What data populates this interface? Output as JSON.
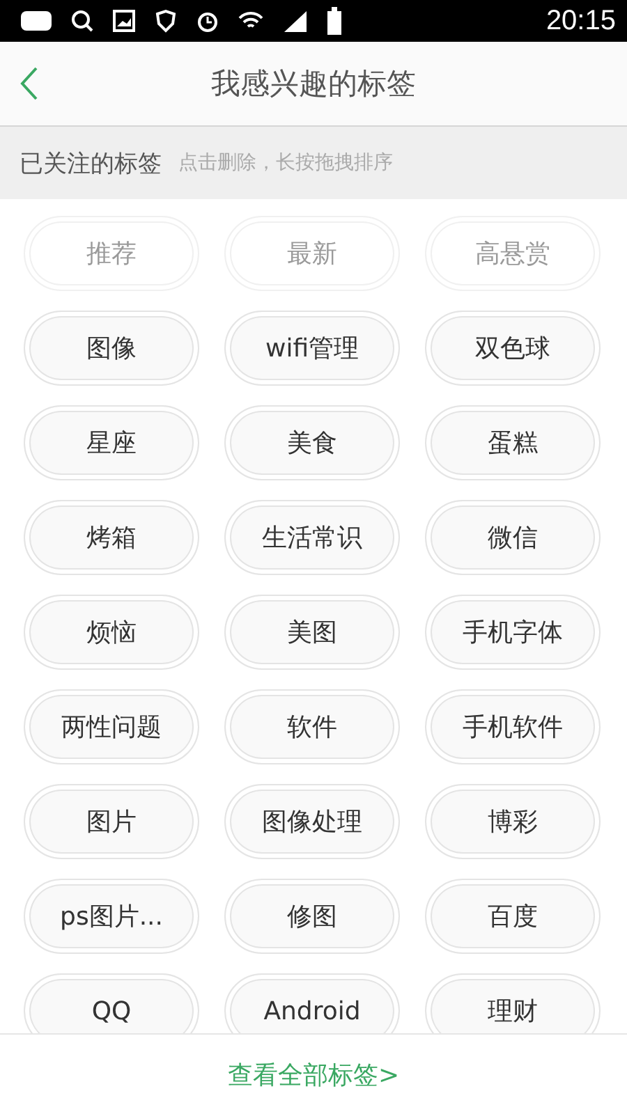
{
  "status_bar": {
    "time": "20:15"
  },
  "header": {
    "title": "我感兴趣的标签"
  },
  "section": {
    "title": "已关注的标签",
    "hint": "点击删除，长按拖拽排序"
  },
  "tags": [
    {
      "label": "推荐",
      "disabled": true
    },
    {
      "label": "最新",
      "disabled": true
    },
    {
      "label": "高悬赏",
      "disabled": true
    },
    {
      "label": "图像",
      "disabled": false
    },
    {
      "label": "wifi管理",
      "disabled": false
    },
    {
      "label": "双色球",
      "disabled": false
    },
    {
      "label": "星座",
      "disabled": false
    },
    {
      "label": "美食",
      "disabled": false
    },
    {
      "label": "蛋糕",
      "disabled": false
    },
    {
      "label": "烤箱",
      "disabled": false
    },
    {
      "label": "生活常识",
      "disabled": false
    },
    {
      "label": "微信",
      "disabled": false
    },
    {
      "label": "烦恼",
      "disabled": false
    },
    {
      "label": "美图",
      "disabled": false
    },
    {
      "label": "手机字体",
      "disabled": false
    },
    {
      "label": "两性问题",
      "disabled": false
    },
    {
      "label": "软件",
      "disabled": false
    },
    {
      "label": "手机软件",
      "disabled": false
    },
    {
      "label": "图片",
      "disabled": false
    },
    {
      "label": "图像处理",
      "disabled": false
    },
    {
      "label": "博彩",
      "disabled": false
    },
    {
      "label": "ps图片...",
      "disabled": false
    },
    {
      "label": "修图",
      "disabled": false
    },
    {
      "label": "百度",
      "disabled": false
    },
    {
      "label": "QQ",
      "disabled": false
    },
    {
      "label": "Android",
      "disabled": false
    },
    {
      "label": "理财",
      "disabled": false
    }
  ],
  "footer": {
    "link": "查看全部标签>"
  }
}
